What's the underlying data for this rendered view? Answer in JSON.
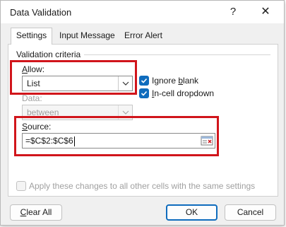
{
  "window": {
    "title": "Data Validation",
    "help_glyph": "?",
    "close_glyph": "✕"
  },
  "tabs": [
    {
      "label": "Settings",
      "selected": true
    },
    {
      "label": "Input Message",
      "selected": false
    },
    {
      "label": "Error Alert",
      "selected": false
    }
  ],
  "settings": {
    "group_label": "Validation criteria",
    "allow": {
      "label_accel": "A",
      "label_rest": "llow:",
      "value": "List"
    },
    "ignore_blank": {
      "label_pre": "Ignore ",
      "label_accel": "b",
      "label_rest": "lank",
      "checked": true
    },
    "in_cell_dropdown": {
      "label_accel": "I",
      "label_rest": "n-cell dropdown",
      "checked": true
    },
    "data": {
      "label": "Data:",
      "value": "between",
      "enabled": false
    },
    "source": {
      "label_accel": "S",
      "label_rest": "ource:",
      "value": "=$C$2:$C$6"
    },
    "apply_all": {
      "label": "Apply these changes to all other cells with the same settings",
      "checked": false,
      "enabled": false
    }
  },
  "buttons": {
    "clear_all_accel": "C",
    "clear_all_rest": "lear All",
    "ok": "OK",
    "cancel": "Cancel"
  },
  "colors": {
    "highlight": "#d1151b",
    "accent": "#0f6cbd"
  },
  "icons": {
    "dropdown": "chevron-down-icon",
    "checkbox": "checkmark-icon",
    "collapse": "collapse-dialog-icon"
  }
}
